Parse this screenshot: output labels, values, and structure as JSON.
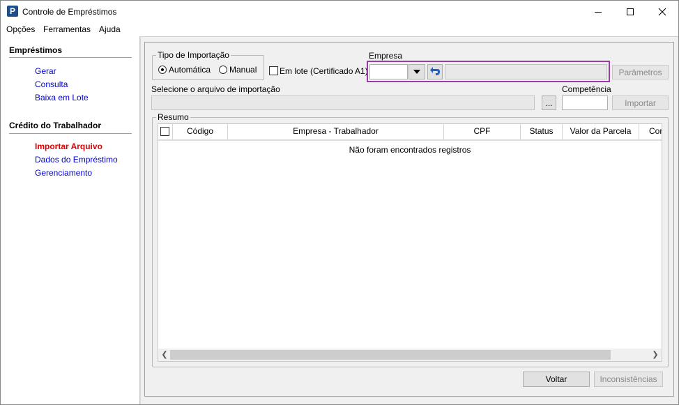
{
  "window": {
    "title": "Controle de Empréstimos",
    "icon_letter": "P"
  },
  "menu": {
    "items": [
      "Opções",
      "Ferramentas",
      "Ajuda"
    ]
  },
  "sidebar": {
    "sections": [
      {
        "title": "Empréstimos",
        "items": [
          "Gerar",
          "Consulta",
          "Baixa em Lote"
        ]
      },
      {
        "title": "Crédito do Trabalhador",
        "items": [
          "Importar Arquivo",
          "Dados do Empréstimo",
          "Gerenciamento"
        ],
        "active": "Importar Arquivo"
      }
    ]
  },
  "import": {
    "tipo_label": "Tipo de Importação",
    "auto_label": "Automática",
    "manual_label": "Manual",
    "selected": "Automática",
    "lote_label": "Em lote (Certificado A1)",
    "empresa_label": "Empresa",
    "parametros_label": "Parâmetros",
    "arquivo_label": "Selecione o arquivo de importação",
    "browse_label": "...",
    "competencia_label": "Competência",
    "importar_label": "Importar"
  },
  "resumo": {
    "title": "Resumo",
    "columns": [
      "Código",
      "Empresa - Trabalhador",
      "CPF",
      "Status",
      "Valor da Parcela",
      "Cor"
    ],
    "empty_message": "Não foram encontrados registros"
  },
  "footer": {
    "voltar_label": "Voltar",
    "inconsistencias_label": "Inconsistências"
  },
  "colors": {
    "accent_highlight": "#9b3aa8",
    "link": "#0000cc",
    "active_link": "#e00000"
  }
}
